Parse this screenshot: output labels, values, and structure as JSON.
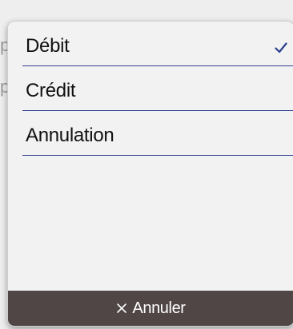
{
  "background": {
    "glyphs": [
      "p",
      "p"
    ]
  },
  "menu": {
    "options": [
      {
        "label": "Débit",
        "selected": true
      },
      {
        "label": "Crédit",
        "selected": false
      },
      {
        "label": "Annulation",
        "selected": false
      }
    ],
    "selected_icon": "checkmark-icon"
  },
  "footer": {
    "cancel_label": "Annuler",
    "cancel_icon": "close-icon"
  },
  "colors": {
    "accent": "#2c3e8f",
    "footer_bg": "#4f4645",
    "popup_bg": "#f2f2f2"
  }
}
